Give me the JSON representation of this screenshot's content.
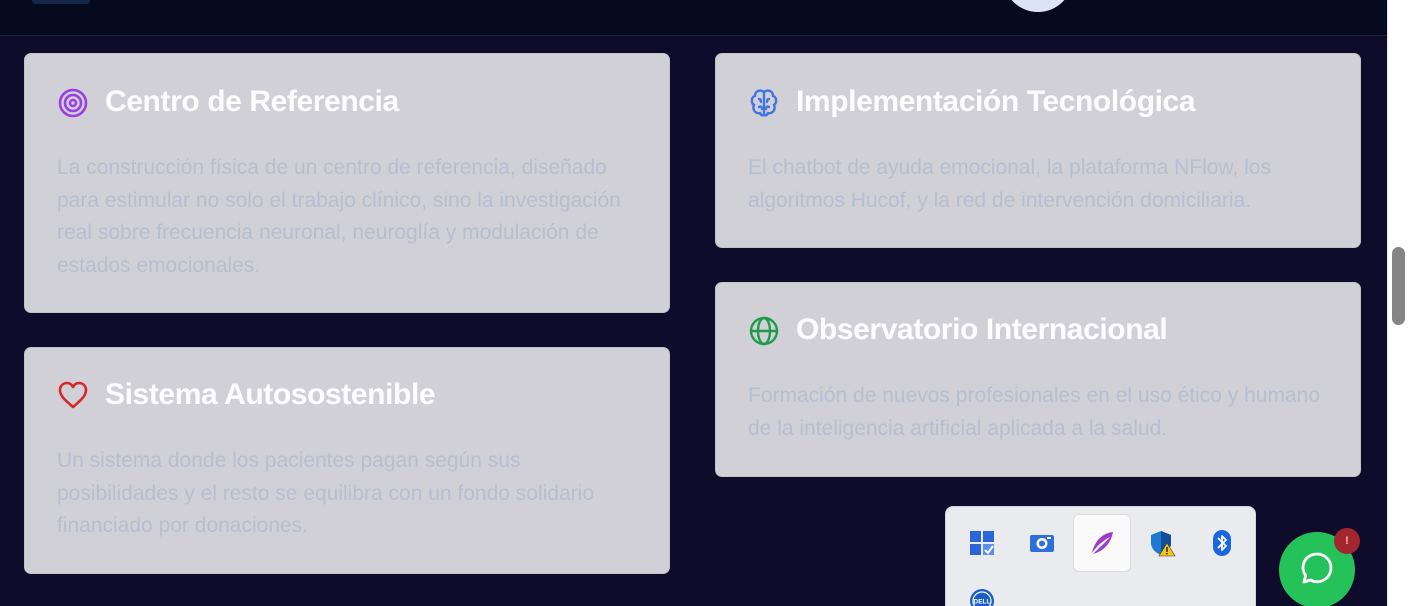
{
  "cards": [
    {
      "icon": "target-icon",
      "title": "Centro de Referencia",
      "description": "La construcción física de un centro de referencia, diseñado para estimular no solo el trabajo clínico, sino la investigación real sobre frecuencia neuronal, neuroglía y modulación de estados emocionales."
    },
    {
      "icon": "brain-icon",
      "title": "Implementación Tecnológica",
      "description": "El chatbot de ayuda emocional, la plataforma NFlow, los algoritmos Hucof, y la red de intervención domiciliaria."
    },
    {
      "icon": "globe-icon",
      "title": "Observatorio Internacional",
      "description": "Formación de nuevos profesionales en el uso ético y humano de la inteligencia artificial aplicada a la salud."
    },
    {
      "icon": "heart-icon",
      "title": "Sistema Autosostenible",
      "description": "Un sistema donde los pacientes pagan según sus posibilidades y el resto se equilibra con un fondo solidario financiado por donaciones."
    }
  ],
  "tray": {
    "items": [
      "widgets-icon",
      "camera-icon",
      "quill-icon",
      "security-warning-icon",
      "bluetooth-icon",
      "dell-icon"
    ]
  },
  "chat": {
    "icon": "whatsapp-icon",
    "badge": "!"
  },
  "colors": {
    "page_background": "#0f0c2b",
    "card_background": "#d1d0d7",
    "title_text": "#fdfdff",
    "description_text": "#b6bfd2",
    "target_icon": "#9b3fe0",
    "brain_icon": "#3f74e3",
    "globe_icon": "#1f9a4a",
    "heart_icon": "#d62828",
    "chat_button": "#25c259"
  }
}
